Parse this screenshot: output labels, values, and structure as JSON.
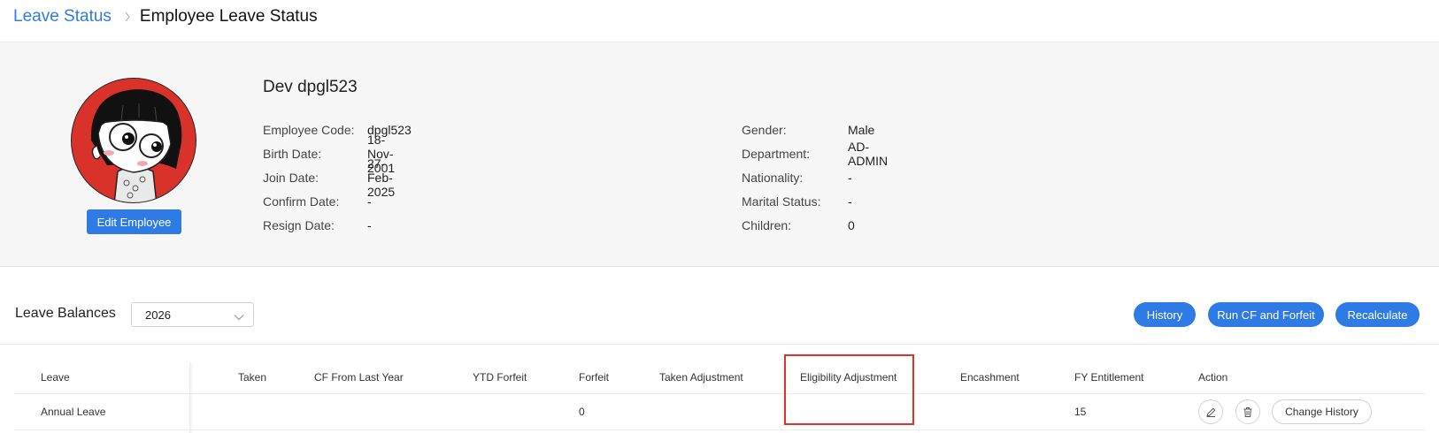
{
  "breadcrumb": {
    "parent": "Leave Status",
    "current": "Employee Leave Status"
  },
  "employee": {
    "name": "Dev dpgl523",
    "edit_label": "Edit Employee",
    "left_fields": [
      {
        "label": "Employee Code:",
        "value": "dpgl523"
      },
      {
        "label": "Birth Date:",
        "value": "18-Nov-2001"
      },
      {
        "label": "Join Date:",
        "value": "27-Feb-2025"
      },
      {
        "label": "Confirm Date:",
        "value": "-"
      },
      {
        "label": "Resign Date:",
        "value": "-"
      }
    ],
    "right_fields": [
      {
        "label": "Gender:",
        "value": "Male"
      },
      {
        "label": "Department:",
        "value": "AD-ADMIN"
      },
      {
        "label": "Nationality:",
        "value": "-"
      },
      {
        "label": "Marital Status:",
        "value": "-"
      },
      {
        "label": "Children:",
        "value": "0"
      }
    ]
  },
  "balances": {
    "title": "Leave Balances",
    "year": "2026",
    "history_label": "History",
    "run_cf_label": "Run CF and Forfeit",
    "recalculate_label": "Recalculate"
  },
  "table": {
    "headers": {
      "leave": "Leave",
      "taken": "Taken",
      "cf_last_year": "CF From Last Year",
      "ytd_forfeit": "YTD Forfeit",
      "forfeit": "Forfeit",
      "taken_adjustment": "Taken Adjustment",
      "eligibility_adjustment": "Eligibility Adjustment",
      "encashment": "Encashment",
      "fy_entitlement": "FY Entitlement",
      "action": "Action"
    },
    "rows": [
      {
        "leave": "Annual Leave",
        "taken": "",
        "cf_last_year": "",
        "ytd_forfeit": "",
        "forfeit": "0",
        "taken_adjustment": "",
        "eligibility_adjustment": "",
        "encashment": "",
        "fy_entitlement": "15",
        "change_history_label": "Change History"
      }
    ]
  },
  "icons": {
    "breadcrumb_separator": "chevron-right-icon",
    "year_dropdown": "chevron-down-icon",
    "edit": "pencil-icon",
    "delete": "trash-icon"
  },
  "colors": {
    "primary": "#2f7be5",
    "highlight": "#e0322a",
    "panel_bg": "#f7f7f7"
  }
}
